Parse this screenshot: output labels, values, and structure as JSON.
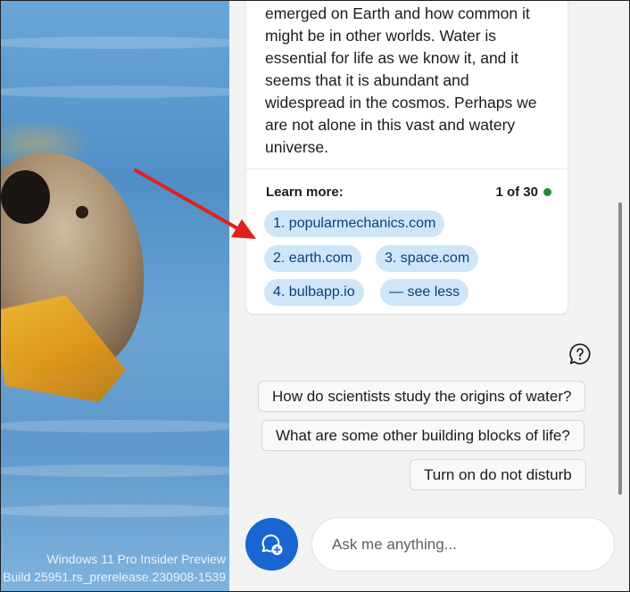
{
  "wallpaper": {
    "watermark_line1": "Windows 11 Pro Insider Preview",
    "watermark_line2": "Build 25951.rs_prerelease.230908-1539"
  },
  "response": {
    "text": "emerged on Earth and how common it might be in other worlds. Water is essential for life as we know it, and it seems that it is abundant and widespread in the cosmos. Perhaps we are not alone in this vast and watery universe.",
    "learn_more_label": "Learn more:",
    "pager": "1 of 30",
    "sources": [
      {
        "label": "1. popularmechanics.com"
      },
      {
        "label": "2. earth.com"
      },
      {
        "label": "3. space.com"
      },
      {
        "label": "4. bulbapp.io"
      }
    ],
    "see_less_label": "— see less"
  },
  "suggestions": [
    "How do scientists study the origins of water?",
    "What are some other building blocks of life?",
    "Turn on do not disturb"
  ],
  "composer": {
    "placeholder": "Ask me anything..."
  },
  "icons": {
    "help": "question-bubble-icon",
    "new_chat": "new-chat-icon"
  },
  "colors": {
    "accent": "#1966d2",
    "chip_bg": "#cfe6f8",
    "chip_text": "#0a3f7a",
    "status_dot": "#1e8e3e",
    "annotation_arrow": "#e0201e"
  }
}
